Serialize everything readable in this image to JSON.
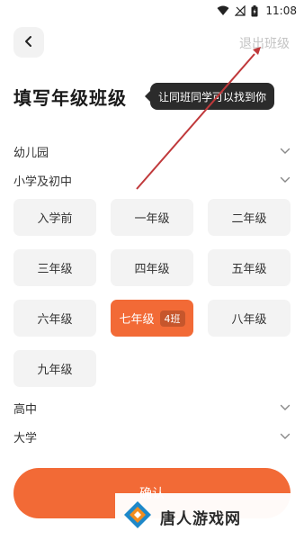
{
  "status_bar": {
    "time": "11:08"
  },
  "header": {
    "exit_label": "退出班级"
  },
  "title": {
    "text": "填写年级班级",
    "tooltip": "让同班同学可以找到你"
  },
  "sections": {
    "kindergarten": "幼儿园",
    "primary_middle": "小学及初中",
    "high_school": "高中",
    "university": "大学"
  },
  "grades": [
    {
      "label": "入学前"
    },
    {
      "label": "一年级"
    },
    {
      "label": "二年级"
    },
    {
      "label": "三年级"
    },
    {
      "label": "四年级"
    },
    {
      "label": "五年级"
    },
    {
      "label": "六年级"
    },
    {
      "label": "七年级",
      "selected": true,
      "class_badge": "4班"
    },
    {
      "label": "八年级"
    },
    {
      "label": "九年级"
    }
  ],
  "confirm_label": "确认",
  "watermark": {
    "text": "唐人游戏网"
  },
  "colors": {
    "accent": "#f26a36",
    "annotation_arrow": "#c0393b"
  }
}
